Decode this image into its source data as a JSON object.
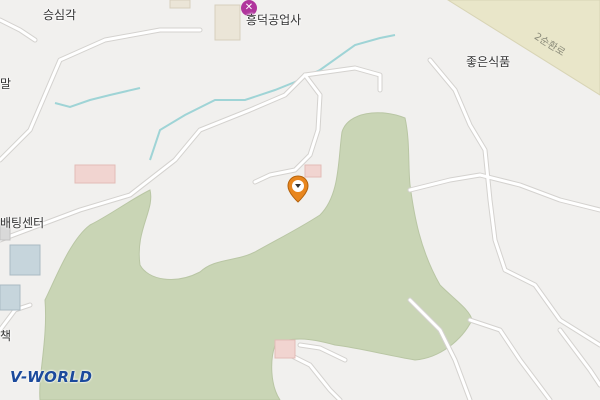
{
  "map": {
    "labels": {
      "seungsimgak": "승심각",
      "heungdeok": "흥덕공업사",
      "joeun": "좋은식품",
      "batting": "배팅센터",
      "edge_left_1": "말",
      "edge_left_2": "책"
    },
    "road_label": "2순환로",
    "poi_icon_glyph": "✕",
    "colors": {
      "background": "#f1f0ee",
      "park": "#c9d5b5",
      "major_road": "#e9e6c9",
      "stream": "#9fd4d6",
      "pin": "#e8861e",
      "building": "#f1d4d0",
      "poi": "#b0359c"
    },
    "marker": {
      "icon": "location-pin-icon"
    },
    "logo": {
      "prefix": "V",
      "suffix": "-WORLD"
    }
  }
}
